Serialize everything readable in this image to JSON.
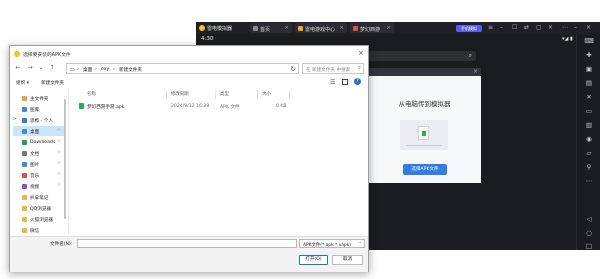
{
  "emulator": {
    "app_name": "雷电模拟器",
    "tabs": [
      {
        "label": "首页",
        "icon": "home-icon",
        "color": "#8a8a8a"
      },
      {
        "label": "雷电游戏中心",
        "icon": "game-center-icon",
        "color": "#f5a524"
      },
      {
        "label": "梦幻西游",
        "icon": "game-icon",
        "color": "#e34d3d"
      }
    ],
    "phone_button": "手机模拟",
    "time": "4:30",
    "signal": "▾◢ ▮",
    "accent_color": "#5b5cf6"
  },
  "dropzone": {
    "title": "从电脑传到模拟器",
    "button": "选择APK文件",
    "button_color": "#2f7dec"
  },
  "dialog": {
    "title": "选择要安装的APK文件",
    "address": {
      "parts": [
        "桌面",
        "›",
        "exy",
        "›",
        "新建文件夹"
      ]
    },
    "search_placeholder": "在 新建文件夹 中搜索",
    "toolbar": {
      "organize": "组织 ▾",
      "new_folder": "新建文件夹"
    },
    "nav_items": [
      {
        "label": "主文件夹",
        "icon": "home-folder-icon",
        "color": "#e2a83a",
        "expand": ""
      },
      {
        "label": "图库",
        "icon": "gallery-icon",
        "color": "#3a8be2",
        "expand": ""
      },
      {
        "label": "思桦 - 个人",
        "icon": "cloud-icon",
        "color": "#2a7fd4",
        "expand": ">"
      },
      {
        "label": "桌面",
        "icon": "desktop-icon",
        "color": "#3a8be2",
        "pin": "📌",
        "selected": true
      },
      {
        "label": "Downloads",
        "icon": "download-icon",
        "color": "#2a9d4a",
        "pin": "📌"
      },
      {
        "label": "文档",
        "icon": "documents-icon",
        "color": "#6a7a8c",
        "pin": "📌"
      },
      {
        "label": "图片",
        "icon": "pictures-icon",
        "color": "#3a8be2",
        "pin": "📌"
      },
      {
        "label": "音乐",
        "icon": "music-icon",
        "color": "#e0504a",
        "pin": "📌"
      },
      {
        "label": "视频",
        "icon": "videos-icon",
        "color": "#8a4fd4",
        "pin": "📌"
      },
      {
        "label": "扒拿笔记",
        "icon": "folder-icon",
        "color": "#e8b93c"
      },
      {
        "label": "QQ浏览器",
        "icon": "folder-icon",
        "color": "#e8b93c"
      },
      {
        "label": "火狐浏览器",
        "icon": "folder-icon",
        "color": "#e8b93c"
      },
      {
        "label": "微信",
        "icon": "folder-icon",
        "color": "#e8b93c"
      }
    ],
    "columns": [
      "名称",
      "修改日期",
      "类型",
      "大小"
    ],
    "files": [
      {
        "name": "梦幻西游手游.apk",
        "modified": "2024/9/13 16:29",
        "type": "APK 文件",
        "size": "0 KB"
      }
    ],
    "filename_label": "文件名(N):",
    "filename_value": "",
    "filetype": "APK文件(*.apk *.xapk)",
    "open_button": "打开(O)",
    "cancel_button": "取消"
  }
}
